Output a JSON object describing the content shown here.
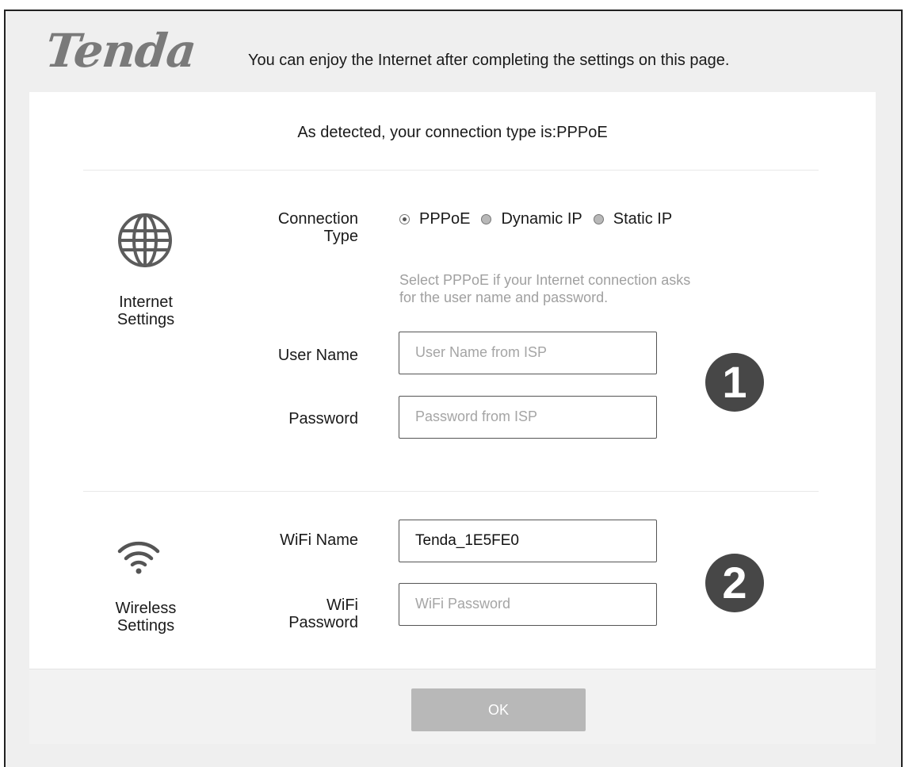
{
  "header": {
    "logo": "Tenda",
    "tagline": "You can enjoy the Internet after completing the settings on this page."
  },
  "detected_text": "As detected, your connection type is:PPPoE",
  "internet": {
    "icon": "globe-icon",
    "section_label_line1": "Internet",
    "section_label_line2": "Settings",
    "connection_type_label_line1": "Connection",
    "connection_type_label_line2": "Type",
    "options": [
      {
        "label": "PPPoE",
        "selected": true
      },
      {
        "label": "Dynamic IP",
        "selected": false
      },
      {
        "label": "Static IP",
        "selected": false
      }
    ],
    "hint_line1": "Select PPPoE if your Internet connection asks",
    "hint_line2": "for the user name and password.",
    "username_label": "User Name",
    "username_placeholder": "User Name from ISP",
    "username_value": "",
    "password_label": "Password",
    "password_placeholder": "Password from ISP",
    "password_value": "",
    "step": "1"
  },
  "wireless": {
    "icon": "wifi-icon",
    "section_label_line1": "Wireless",
    "section_label_line2": "Settings",
    "wifi_name_label": "WiFi Name",
    "wifi_name_value": "Tenda_1E5FE0",
    "wifi_password_label_line1": "WiFi",
    "wifi_password_label_line2": "Password",
    "wifi_password_placeholder": "WiFi Password",
    "wifi_password_value": "",
    "step": "2"
  },
  "footer": {
    "ok_label": "OK"
  },
  "colors": {
    "logo": "#7a7a7a",
    "badge": "#474747",
    "button_disabled": "#b8b8b8",
    "hint_text": "#a0a0a0"
  }
}
